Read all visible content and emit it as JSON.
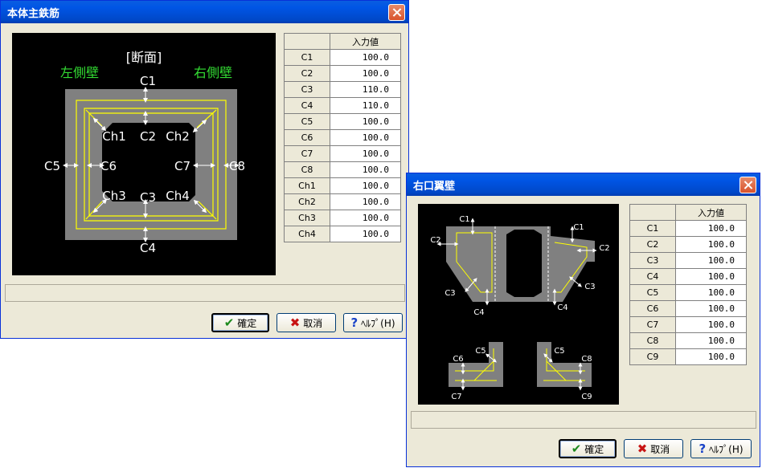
{
  "main_window": {
    "title": "本体主鉄筋",
    "diagram": {
      "title": "[断面]",
      "left_wall": "左側壁",
      "right_wall": "右側壁",
      "labels": {
        "c1": "C1",
        "c2": "C2",
        "c3": "C3",
        "c4": "C4",
        "c5": "C5",
        "c6": "C6",
        "c7": "C7",
        "c8": "C8",
        "ch1": "Ch1",
        "ch2": "Ch2",
        "ch3": "Ch3",
        "ch4": "Ch4"
      }
    },
    "table": {
      "header": "入力値",
      "rows": [
        {
          "label": "C1",
          "value": "100.0"
        },
        {
          "label": "C2",
          "value": "100.0"
        },
        {
          "label": "C3",
          "value": "110.0"
        },
        {
          "label": "C4",
          "value": "110.0"
        },
        {
          "label": "C5",
          "value": "100.0"
        },
        {
          "label": "C6",
          "value": "100.0"
        },
        {
          "label": "C7",
          "value": "100.0"
        },
        {
          "label": "C8",
          "value": "100.0"
        },
        {
          "label": "Ch1",
          "value": "100.0"
        },
        {
          "label": "Ch2",
          "value": "100.0"
        },
        {
          "label": "Ch3",
          "value": "100.0"
        },
        {
          "label": "Ch4",
          "value": "100.0"
        }
      ]
    },
    "buttons": {
      "ok": "確定",
      "cancel": "取消",
      "help": "ﾍﾙﾌﾟ(H)"
    }
  },
  "wing_window": {
    "title": "右口翼壁",
    "diagram": {
      "labels": {
        "c1": "C1",
        "c2": "C2",
        "c3": "C3",
        "c4": "C4",
        "c5": "C5",
        "c6": "C6",
        "c7": "C7",
        "c8": "C8",
        "c9": "C9"
      }
    },
    "table": {
      "header": "入力値",
      "rows": [
        {
          "label": "C1",
          "value": "100.0"
        },
        {
          "label": "C2",
          "value": "100.0"
        },
        {
          "label": "C3",
          "value": "100.0"
        },
        {
          "label": "C4",
          "value": "100.0"
        },
        {
          "label": "C5",
          "value": "100.0"
        },
        {
          "label": "C6",
          "value": "100.0"
        },
        {
          "label": "C7",
          "value": "100.0"
        },
        {
          "label": "C8",
          "value": "100.0"
        },
        {
          "label": "C9",
          "value": "100.0"
        }
      ]
    },
    "buttons": {
      "ok": "確定",
      "cancel": "取消",
      "help": "ﾍﾙﾌﾟ(H)"
    }
  },
  "colors": {
    "wall_label": "#33dd33",
    "concrete": "#808080",
    "rebar": "#ffff00"
  }
}
